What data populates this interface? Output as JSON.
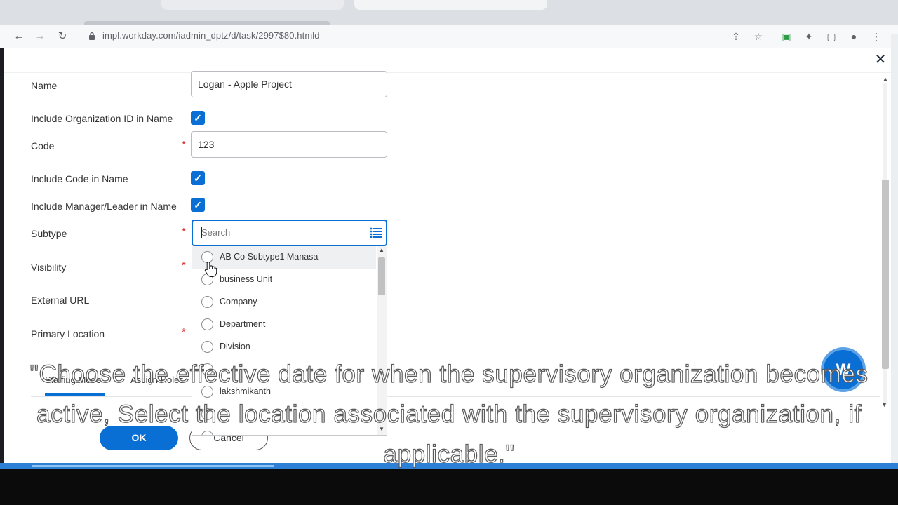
{
  "browser": {
    "url": "impl.workday.com/iadmin_dptz/d/task/2997$80.htmld"
  },
  "form": {
    "name_label": "Name",
    "name_value": "Logan - Apple Project",
    "include_org_id_label": "Include Organization ID in Name",
    "include_org_id_checked": true,
    "code_label": "Code",
    "code_value": "123",
    "include_code_label": "Include Code in Name",
    "include_code_checked": true,
    "include_manager_label": "Include Manager/Leader in Name",
    "include_manager_checked": true,
    "subtype_label": "Subtype",
    "subtype_search_placeholder": "Search",
    "visibility_label": "Visibility",
    "external_url_label": "External URL",
    "primary_location_label": "Primary Location",
    "required_marker": "*",
    "check_glyph": "✓"
  },
  "subtype_options": [
    "AB Co Subtype1 Manasa",
    "business Unit",
    "Company",
    "Department",
    "Division",
    "lakshmikanth"
  ],
  "tabs": {
    "staffing": "Staffing Model",
    "assign_roles": "Assign Roles"
  },
  "footer": {
    "ok_label": "OK",
    "cancel_label": "Cancel"
  },
  "assistant": {
    "glyph": "W"
  },
  "caption": {
    "text": "\"Choose the effective date for when the supervisory organization becomes active, Select the location associated with the supervisory organization, if applicable.\""
  },
  "colors": {
    "primary": "#0a6fd5",
    "required": "#d62f2f"
  },
  "icons": {
    "close": "close-icon",
    "list": "list-icon",
    "radio": "radio-icon",
    "checkbox": "checkbox-checked-icon",
    "cursor": "hand-cursor-icon"
  }
}
